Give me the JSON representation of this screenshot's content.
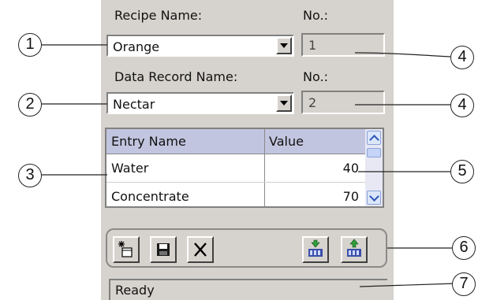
{
  "recipe": {
    "name_label": "Recipe Name:",
    "no_label": "No.:",
    "selected": "Orange",
    "number": "1"
  },
  "data_record": {
    "name_label": "Data Record Name:",
    "no_label": "No.:",
    "selected": "Nectar",
    "number": "2"
  },
  "table": {
    "headers": [
      "Entry Name",
      "Value"
    ],
    "rows": [
      {
        "name": "Water",
        "value": "40"
      },
      {
        "name": "Concentrate",
        "value": "70"
      }
    ]
  },
  "toolbar": {
    "buttons": [
      "new-record-icon",
      "save-icon",
      "delete-icon",
      "write-to-plc-icon",
      "read-from-plc-icon"
    ]
  },
  "status": {
    "text": "Ready"
  },
  "callouts": [
    "1",
    "2",
    "3",
    "4",
    "4",
    "5",
    "6",
    "7"
  ],
  "colors": {
    "panel": "#d6d3ce",
    "table_header": "#c2c5df",
    "scroll_accent": "#2c55b8"
  }
}
